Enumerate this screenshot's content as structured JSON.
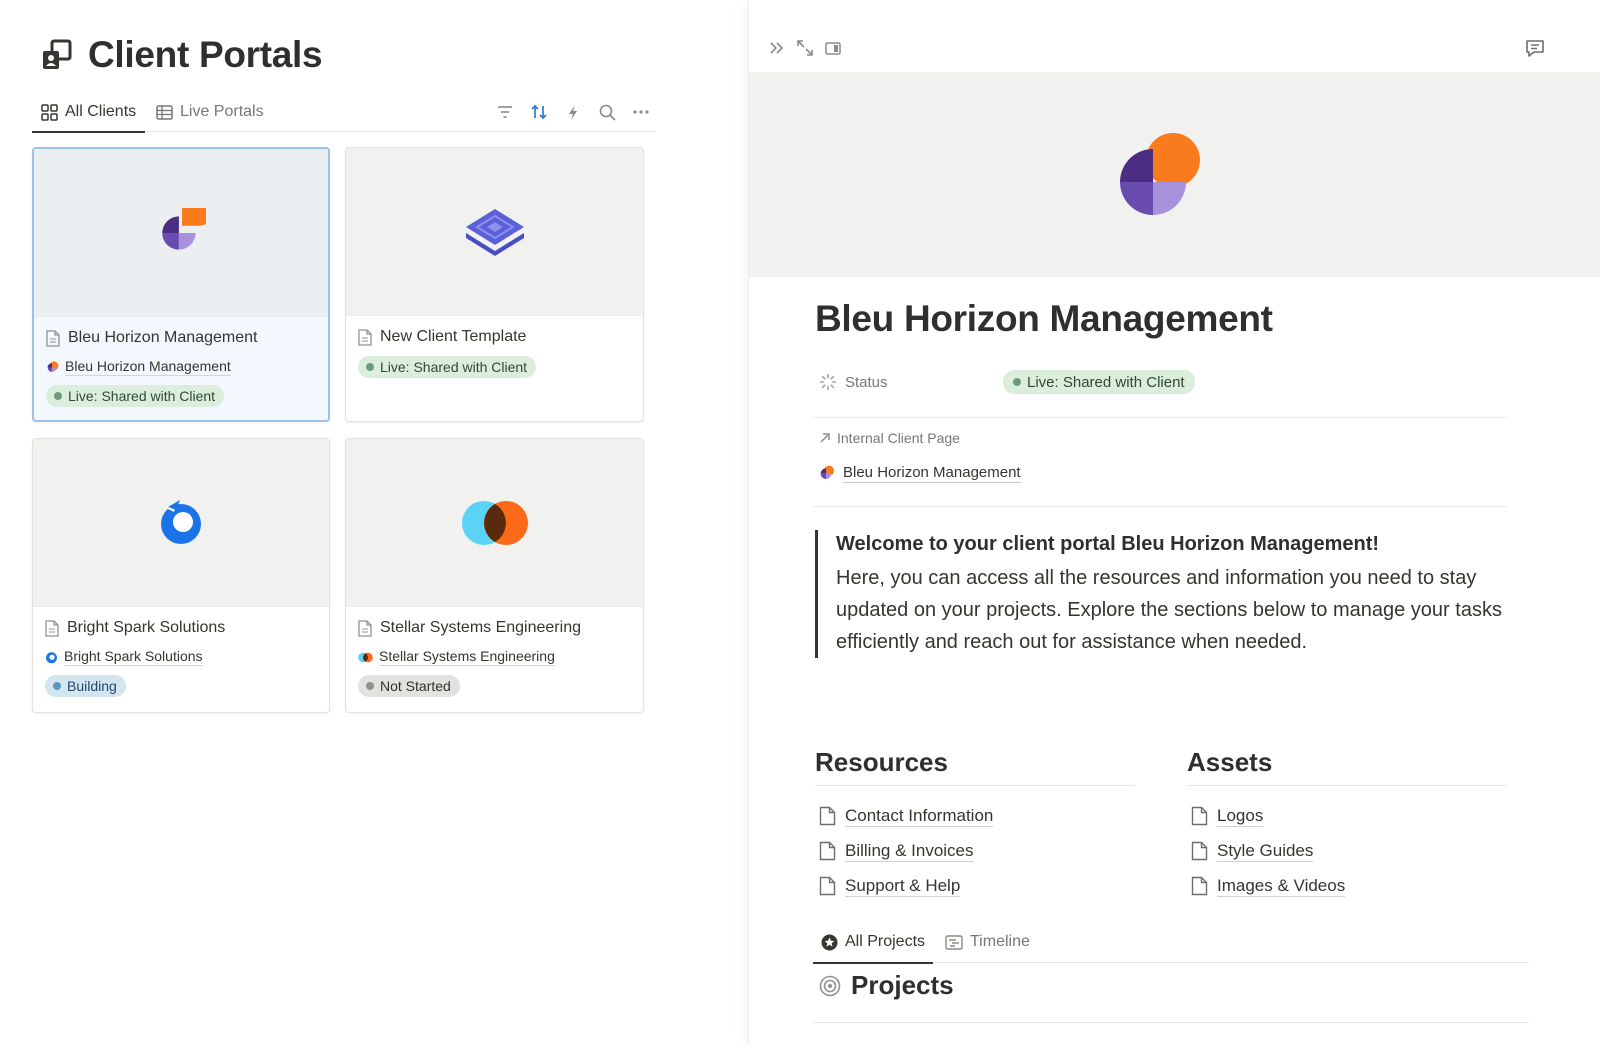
{
  "database": {
    "title": "Client Portals",
    "icon": "client-portal-icon",
    "views": [
      {
        "label": "All Clients",
        "icon": "gallery-icon",
        "active": true
      },
      {
        "label": "Live Portals",
        "icon": "table-icon",
        "active": false
      }
    ],
    "toolbar": [
      "filter-icon",
      "sort-icon",
      "automation-icon",
      "search-icon",
      "more-icon"
    ],
    "cards": [
      {
        "name": "Bleu Horizon Management",
        "relation": "Bleu Horizon Management",
        "status": "Live: Shared with Client",
        "status_color": "green",
        "logo": "bleu-horizon-logo"
      },
      {
        "name": "New Client Template",
        "relation": "",
        "status": "Live: Shared with Client",
        "status_color": "green",
        "logo": "layers-logo"
      },
      {
        "name": "Bright Spark Solutions",
        "relation": "Bright Spark Solutions",
        "status": "Building",
        "status_color": "blue",
        "logo": "bright-spark-logo"
      },
      {
        "name": "Stellar Systems Engineering",
        "relation": "Stellar Systems Engineering",
        "status": "Not Started",
        "status_color": "gray",
        "logo": "stellar-logo"
      }
    ]
  },
  "page": {
    "title": "Bleu Horizon Management",
    "status_label": "Status",
    "status_value": "Live: Shared with Client",
    "relation_label": "Internal Client Page",
    "relation_value": "Bleu Horizon Management",
    "callout_title": "Welcome to your client portal Bleu Horizon Management!",
    "callout_body": "Here, you can access all the resources and information you need to stay updated on your projects. Explore the sections below to manage your tasks efficiently and reach out for assistance when needed.",
    "resources": {
      "heading": "Resources",
      "items": [
        "Contact Information",
        "Billing & Invoices",
        "Support & Help"
      ]
    },
    "assets": {
      "heading": "Assets",
      "items": [
        "Logos",
        "Style Guides",
        "Images & Videos"
      ]
    },
    "tabs": [
      {
        "label": "All Projects",
        "icon": "star-icon",
        "active": true
      },
      {
        "label": "Timeline",
        "icon": "timeline-icon",
        "active": false
      }
    ],
    "projects_heading": "Projects"
  },
  "colors": {
    "orange": "#fa7a1e",
    "purple_dark": "#4b2d83",
    "purple_mid": "#6a4bb0",
    "purple_light": "#a892dc",
    "blue_logo": "#1a74e8",
    "indigo": "#5b5fd8",
    "cyan": "#5ad3f6",
    "status_green": "#dbeddb"
  }
}
